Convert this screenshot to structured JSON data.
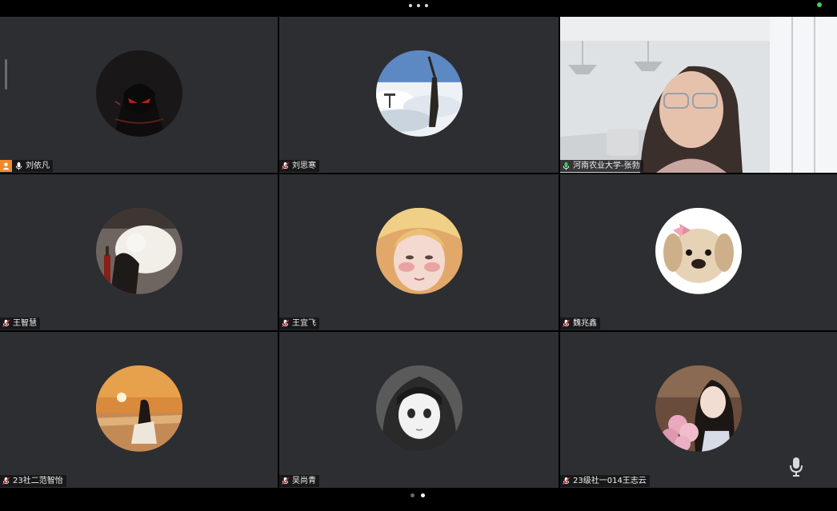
{
  "participants": [
    {
      "name": "刘依凡"
    },
    {
      "name": "刘思寒"
    },
    {
      "name": "河南农业大学-张勃"
    },
    {
      "name": "王智慧"
    },
    {
      "name": "王宜飞"
    },
    {
      "name": "魏兆鑫"
    },
    {
      "name": "23社二范智怡"
    },
    {
      "name": "吴尚青"
    },
    {
      "name": "23级社一014王志云"
    }
  ],
  "pager": {
    "pages": 2,
    "current": 2
  },
  "colors": {
    "tile_bg": "#2d2e31",
    "active_border": "#5fcf6a",
    "host_badge": "#ef8a2a",
    "status": "#3fcf5a"
  },
  "icons": [
    "more-icon",
    "host-icon",
    "mic-icon",
    "muted-mic-icon",
    "microphone-icon"
  ]
}
